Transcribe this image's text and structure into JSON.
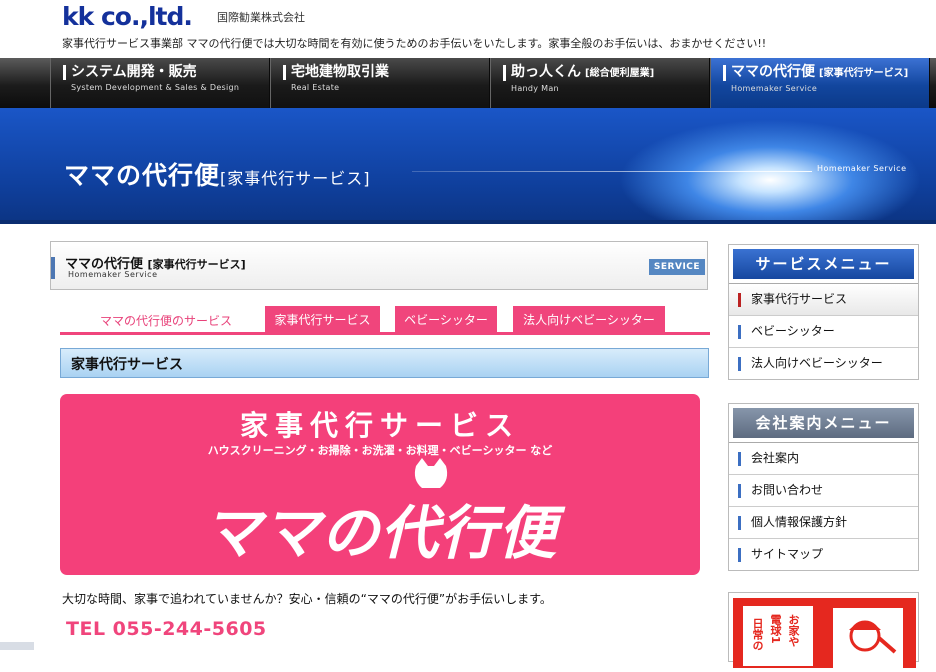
{
  "header": {
    "logo": "kk co.,ltd.",
    "company": "国際勧業株式会社",
    "tagline": "家事代行サービス事業部 ママの代行便では大切な時間を有効に使うためのお手伝いをいたします。家事全般のお手伝いは、おまかせください!!"
  },
  "nav": [
    {
      "title": "システム開発・販売",
      "badge": "",
      "sub": "System Development & Sales & Design"
    },
    {
      "title": "宅地建物取引業",
      "badge": "",
      "sub": "Real Estate"
    },
    {
      "title": "助っ人くん",
      "badge": "[総合便利屋業]",
      "sub": "Handy Man"
    },
    {
      "title": "ママの代行便",
      "badge": "[家事代行サービス]",
      "sub": "Homemaker Service"
    }
  ],
  "banner": {
    "title": "ママの代行便",
    "title_bracket": "[家事代行サービス]",
    "sub": "Homemaker Service"
  },
  "section": {
    "title": "ママの代行便",
    "title_bracket": "[家事代行サービス]",
    "sub": "Homemaker Service",
    "tag": "SERVICE"
  },
  "tabs": {
    "plain": "ママの代行便のサービス",
    "items": [
      "家事代行サービス",
      "ベビーシッター",
      "法人向けベビーシッター"
    ]
  },
  "subheading": "家事代行サービス",
  "hero": {
    "title": "家事代行サービス",
    "sub": "ハウスクリーニング・お掃除・お洗濯・お料理・ベビーシッター など",
    "logo": "ママの代行便"
  },
  "intro": "大切な時間、家事で追われていませんか？安心・信頼の“ママの代行便”がお手伝いします。",
  "tel": "TEL 055-244-5605",
  "sidebar": {
    "service_menu": {
      "title": "サービスメニュー",
      "items": [
        "家事代行サービス",
        "ベビーシッター",
        "法人向けベビーシッター"
      ]
    },
    "company_menu": {
      "title": "会社案内メニュー",
      "items": [
        "会社案内",
        "お問い合わせ",
        "個人情報保護方針",
        "サイトマップ"
      ]
    },
    "ad": {
      "col1": "日常の",
      "col2": "電球1",
      "col3": "お家や"
    }
  },
  "colors": {
    "brand_blue": "#14319b",
    "accent_pink": "#f0457c",
    "nav_active": "#12469e"
  }
}
